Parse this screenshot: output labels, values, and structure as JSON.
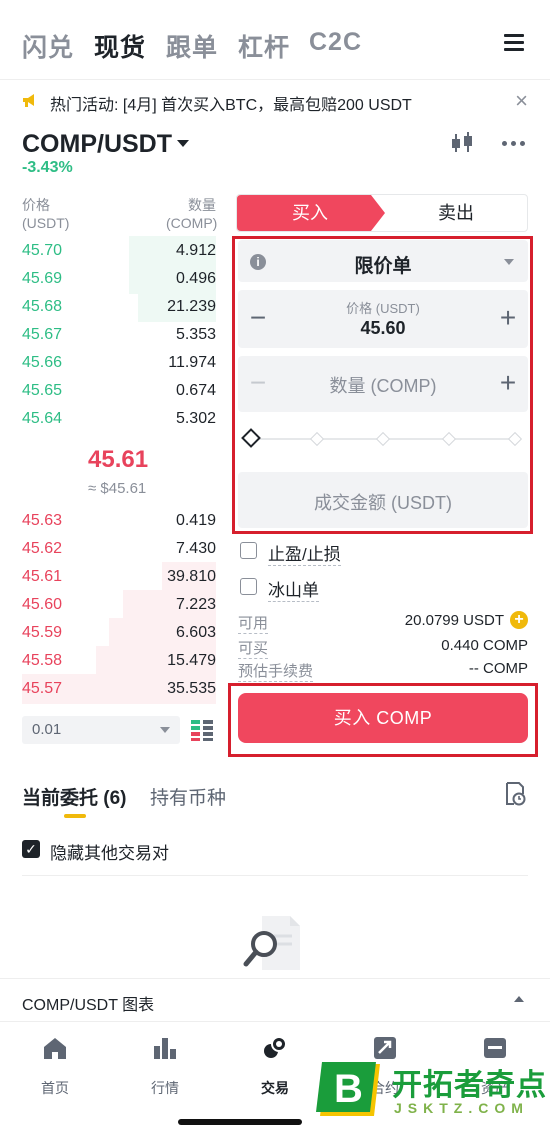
{
  "top_tabs": [
    "闪兑",
    "现货",
    "跟单",
    "杠杆",
    "C2C"
  ],
  "banner": {
    "text": "热门活动: [4月] 首次买入BTC，最高包赔200 USDT",
    "close": "×"
  },
  "pair": {
    "symbol": "COMP/USDT",
    "change": "-3.43%"
  },
  "orderbook": {
    "price_header": "价格",
    "price_unit": "(USDT)",
    "qty_header": "数量",
    "qty_unit": "(COMP)",
    "asks_top": [
      {
        "price": "45.70",
        "qty": "4.912",
        "depth": 0.45
      },
      {
        "price": "45.69",
        "qty": "0.496",
        "depth": 0.45
      },
      {
        "price": "45.68",
        "qty": "21.239",
        "depth": 0.4
      },
      {
        "price": "45.67",
        "qty": "5.353",
        "depth": 0.0
      },
      {
        "price": "45.66",
        "qty": "11.974",
        "depth": 0.0
      },
      {
        "price": "45.65",
        "qty": "0.674",
        "depth": 0.0
      },
      {
        "price": "45.64",
        "qty": "5.302",
        "depth": 0.0
      }
    ],
    "mid_price": "45.61",
    "mid_fiat": "≈ $45.61",
    "bids_bottom": [
      {
        "price": "45.63",
        "qty": "0.419",
        "depth": 0.0
      },
      {
        "price": "45.62",
        "qty": "7.430",
        "depth": 0.0
      },
      {
        "price": "45.61",
        "qty": "39.810",
        "depth": 0.28
      },
      {
        "price": "45.60",
        "qty": "7.223",
        "depth": 0.48
      },
      {
        "price": "45.59",
        "qty": "6.603",
        "depth": 0.55
      },
      {
        "price": "45.58",
        "qty": "15.479",
        "depth": 0.62
      },
      {
        "price": "45.57",
        "qty": "35.535",
        "depth": 1.0
      }
    ],
    "precision": "0.01"
  },
  "trade": {
    "buy_label": "买入",
    "sell_label": "卖出",
    "order_type": "限价单",
    "price_label": "价格 (USDT)",
    "price_value": "45.60",
    "qty_placeholder": "数量 (COMP)",
    "total_placeholder": "成交金额 (USDT)",
    "tp_sl": "止盈/止损",
    "iceberg": "冰山单",
    "available_label": "可用",
    "available_value": "20.0799 USDT",
    "can_buy_label": "可买",
    "can_buy_value": "0.440 COMP",
    "fee_label": "预估手续费",
    "fee_value": "-- COMP",
    "submit": "买入 COMP"
  },
  "orders": {
    "tab_open": "当前委托 (6)",
    "tab_holdings": "持有币种",
    "hide_other": "隐藏其他交易对"
  },
  "chart_bar": "COMP/USDT 图表",
  "bottom_nav": [
    "首页",
    "行情",
    "交易",
    "合约",
    "资产"
  ],
  "watermark": {
    "title": "开拓者奇点",
    "domain": "JSKTZ.COM"
  },
  "colors": {
    "green": "#2ebd85",
    "red": "#e8435c",
    "buy_button": "#f0475e",
    "accent": "#f0b90b",
    "highlight_box": "#d61f2d"
  }
}
